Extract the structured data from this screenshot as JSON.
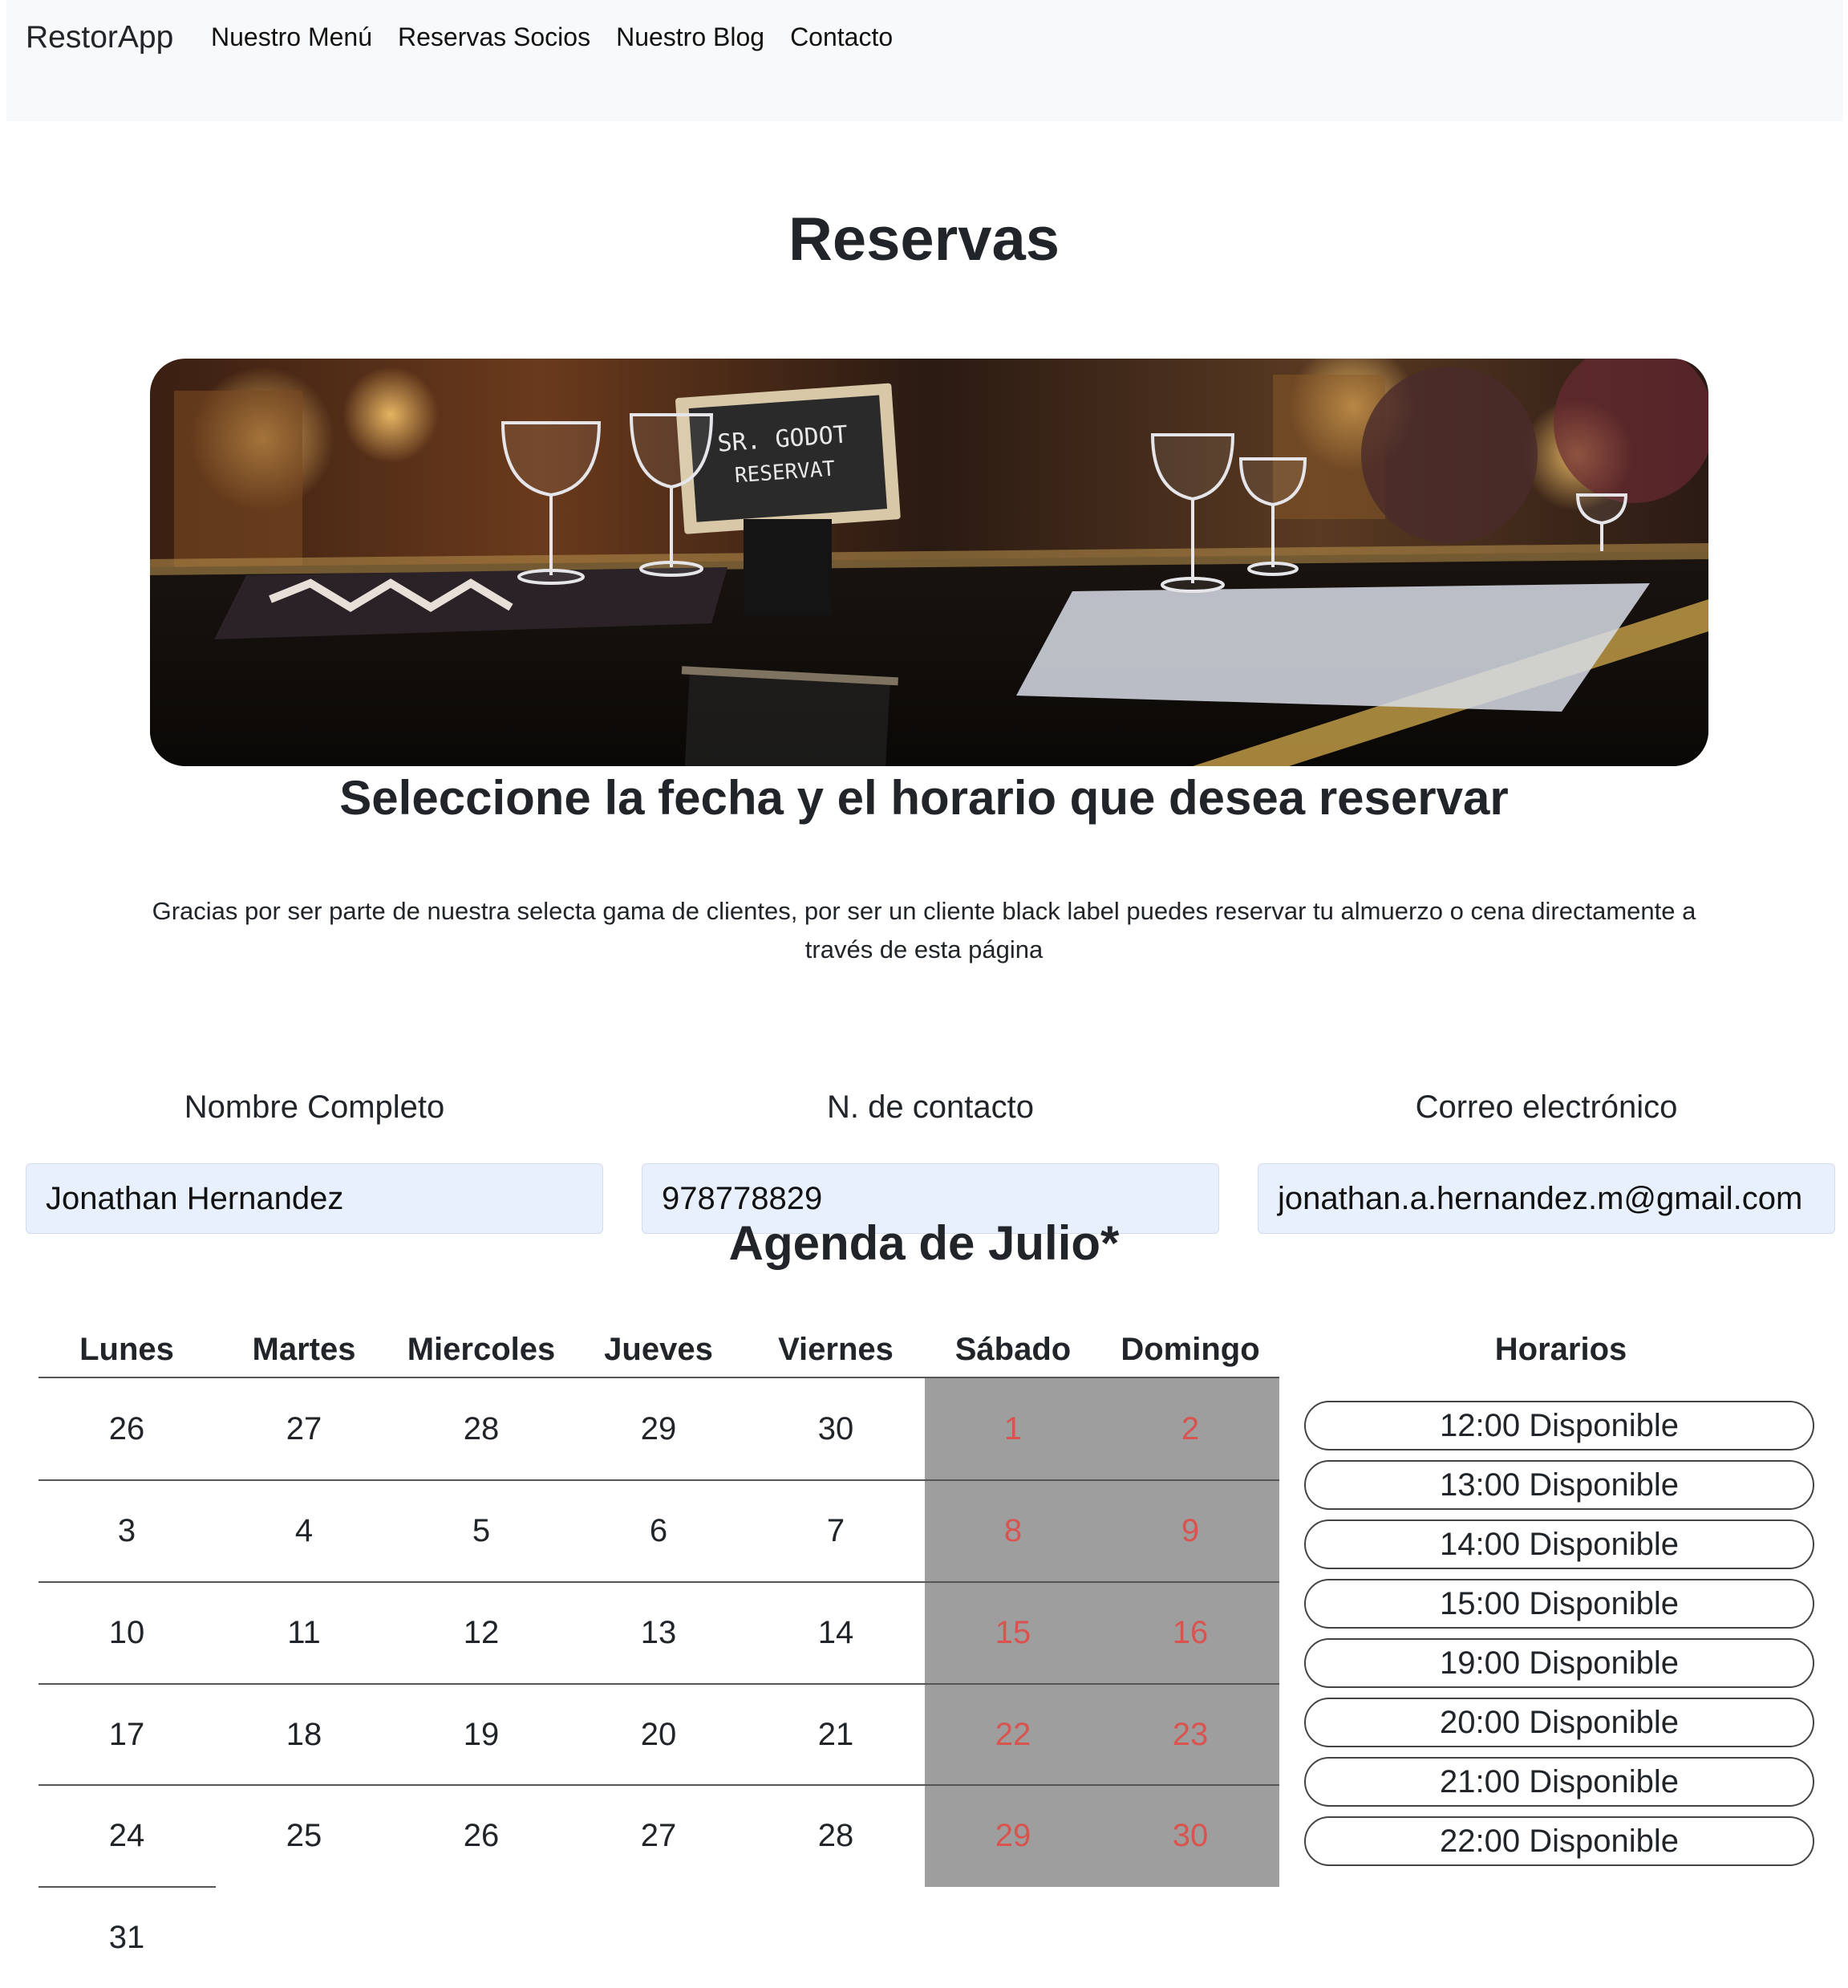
{
  "navbar": {
    "brand": "RestorApp",
    "links": [
      "Nuestro Menú",
      "Reservas Socios",
      "Nuestro Blog",
      "Contacto"
    ]
  },
  "page": {
    "title": "Reservas",
    "hero_image": "restaurant-table-reserved-photo",
    "hero_sign_line1": "SR. GODOT",
    "hero_sign_line2": "RESERVAT",
    "subtitle": "Seleccione la fecha y el horario que desea reservar",
    "intro": "Gracias por ser parte de nuestra selecta gama de clientes, por ser un cliente black label puedes reservar tu almuerzo o cena directamente a través de esta página"
  },
  "form": {
    "name_label": "Nombre Completo",
    "name_value": "Jonathan Hernandez",
    "phone_label": "N. de contacto",
    "phone_value": "978778829",
    "email_label": "Correo electrónico",
    "email_value": "jonathan.a.hernandez.m@gmail.com"
  },
  "agenda": {
    "title": "Agenda de Julio*",
    "days": [
      "Lunes",
      "Martes",
      "Miercoles",
      "Jueves",
      "Viernes",
      "Sábado",
      "Domingo"
    ],
    "weeks": [
      [
        "26",
        "27",
        "28",
        "29",
        "30",
        "1",
        "2"
      ],
      [
        "3",
        "4",
        "5",
        "6",
        "7",
        "8",
        "9"
      ],
      [
        "10",
        "11",
        "12",
        "13",
        "14",
        "15",
        "16"
      ],
      [
        "17",
        "18",
        "19",
        "20",
        "21",
        "22",
        "23"
      ],
      [
        "24",
        "25",
        "26",
        "27",
        "28",
        "29",
        "30"
      ],
      [
        "31"
      ]
    ],
    "weekend_color": "#d9534f",
    "weekend_bg": "#9e9e9e"
  },
  "horarios": {
    "title": "Horarios",
    "slots": [
      "12:00 Disponible",
      "13:00 Disponible",
      "14:00 Disponible",
      "15:00 Disponible",
      "19:00 Disponible",
      "20:00 Disponible",
      "21:00 Disponible",
      "22:00 Disponible"
    ]
  }
}
